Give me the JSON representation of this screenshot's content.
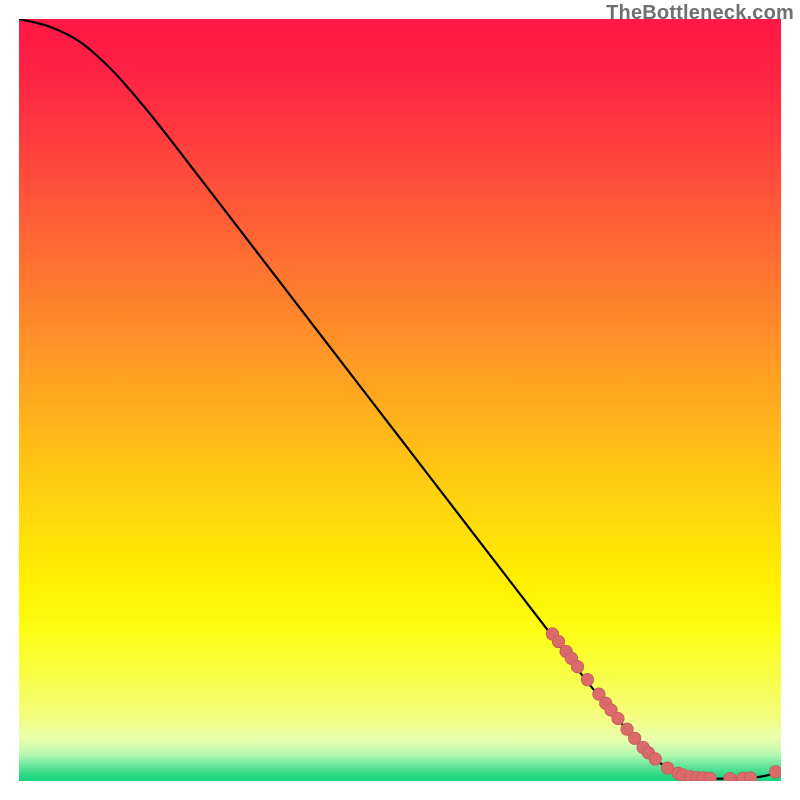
{
  "attribution": "TheBottleneck.com",
  "colors": {
    "curve": "#000000",
    "dot_fill": "#db6b6b",
    "dot_stroke": "#c55a5a",
    "outer_bg": "#000000"
  },
  "chart_data": {
    "type": "line",
    "title": "",
    "xlabel": "",
    "ylabel": "",
    "xlim": [
      0,
      100
    ],
    "ylim": [
      0,
      100
    ],
    "grid": false,
    "curve": [
      {
        "x": 0,
        "y": 100
      },
      {
        "x": 4,
        "y": 99
      },
      {
        "x": 8,
        "y": 97
      },
      {
        "x": 12,
        "y": 93.5
      },
      {
        "x": 16,
        "y": 89
      },
      {
        "x": 20,
        "y": 84
      },
      {
        "x": 30,
        "y": 71
      },
      {
        "x": 40,
        "y": 58
      },
      {
        "x": 50,
        "y": 45
      },
      {
        "x": 60,
        "y": 32
      },
      {
        "x": 70,
        "y": 19
      },
      {
        "x": 75,
        "y": 12.5
      },
      {
        "x": 80,
        "y": 6.5
      },
      {
        "x": 84,
        "y": 2.5
      },
      {
        "x": 86,
        "y": 1.2
      },
      {
        "x": 88,
        "y": 0.6
      },
      {
        "x": 90,
        "y": 0.35
      },
      {
        "x": 93,
        "y": 0.3
      },
      {
        "x": 96,
        "y": 0.4
      },
      {
        "x": 98,
        "y": 0.7
      },
      {
        "x": 100,
        "y": 1.3
      }
    ],
    "series": [
      {
        "name": "points",
        "type": "scatter",
        "points": [
          {
            "x": 70.0,
            "y": 19.3
          },
          {
            "x": 70.8,
            "y": 18.3
          },
          {
            "x": 71.8,
            "y": 17.0
          },
          {
            "x": 72.5,
            "y": 16.1
          },
          {
            "x": 73.3,
            "y": 15.0
          },
          {
            "x": 74.6,
            "y": 13.3
          },
          {
            "x": 76.1,
            "y": 11.4
          },
          {
            "x": 77.0,
            "y": 10.2
          },
          {
            "x": 77.7,
            "y": 9.3
          },
          {
            "x": 78.6,
            "y": 8.2
          },
          {
            "x": 79.8,
            "y": 6.8
          },
          {
            "x": 80.8,
            "y": 5.6
          },
          {
            "x": 81.9,
            "y": 4.4
          },
          {
            "x": 82.6,
            "y": 3.7
          },
          {
            "x": 83.5,
            "y": 2.9
          },
          {
            "x": 85.1,
            "y": 1.7
          },
          {
            "x": 86.5,
            "y": 1.0
          },
          {
            "x": 87.1,
            "y": 0.8
          },
          {
            "x": 88.1,
            "y": 0.55
          },
          {
            "x": 89.0,
            "y": 0.45
          },
          {
            "x": 89.8,
            "y": 0.4
          },
          {
            "x": 90.7,
            "y": 0.35
          },
          {
            "x": 93.3,
            "y": 0.3
          },
          {
            "x": 95.0,
            "y": 0.35
          },
          {
            "x": 96.0,
            "y": 0.4
          },
          {
            "x": 99.3,
            "y": 1.2
          }
        ]
      }
    ],
    "gradient_stops": [
      {
        "offset": 0.0,
        "color": "#ff1745"
      },
      {
        "offset": 0.07,
        "color": "#ff2243"
      },
      {
        "offset": 0.15,
        "color": "#ff3a3f"
      },
      {
        "offset": 0.25,
        "color": "#ff5a37"
      },
      {
        "offset": 0.35,
        "color": "#ff7a2e"
      },
      {
        "offset": 0.45,
        "color": "#ff9a24"
      },
      {
        "offset": 0.55,
        "color": "#ffba18"
      },
      {
        "offset": 0.65,
        "color": "#ffd80c"
      },
      {
        "offset": 0.74,
        "color": "#fff000"
      },
      {
        "offset": 0.8,
        "color": "#fdfd13"
      },
      {
        "offset": 0.86,
        "color": "#f8ff44"
      },
      {
        "offset": 0.91,
        "color": "#f4ff78"
      },
      {
        "offset": 0.945,
        "color": "#eaffad"
      },
      {
        "offset": 0.965,
        "color": "#b6f7b2"
      },
      {
        "offset": 0.98,
        "color": "#67e59a"
      },
      {
        "offset": 0.992,
        "color": "#2dd985"
      },
      {
        "offset": 1.0,
        "color": "#18d37e"
      }
    ]
  }
}
